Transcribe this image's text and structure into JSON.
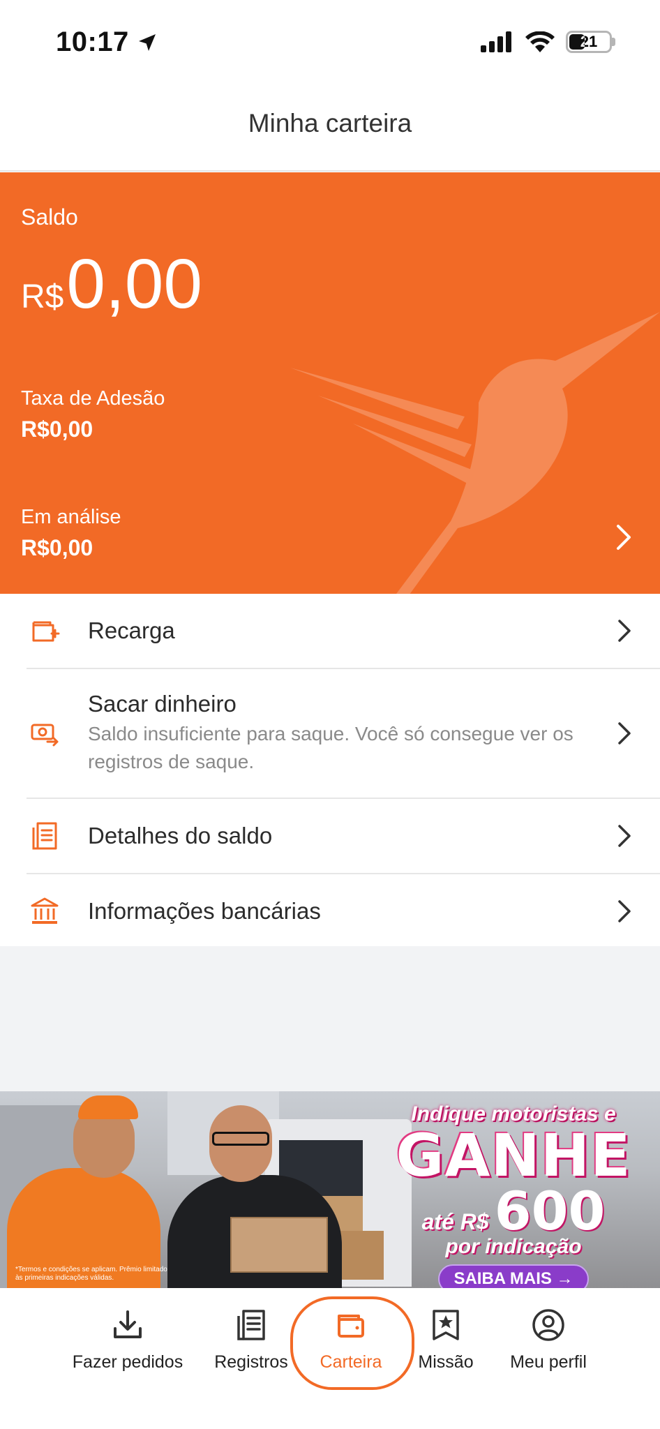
{
  "status_bar": {
    "time": "10:17",
    "battery": "21"
  },
  "header": {
    "title": "Minha carteira"
  },
  "balance": {
    "label": "Saldo",
    "currency": "R$",
    "amount": "0,00",
    "fee_label": "Taxa de Adesão",
    "fee_value": "R$0,00",
    "analysis_label": "Em análise",
    "analysis_value": "R$0,00"
  },
  "menu": [
    {
      "title": "Recarga",
      "icon": "wallet-add-icon"
    },
    {
      "title": "Sacar dinheiro",
      "subtitle": "Saldo insuficiente para saque. Você só consegue ver os registros de saque.",
      "icon": "cash-withdraw-icon"
    },
    {
      "title": "Detalhes do saldo",
      "icon": "document-list-icon"
    },
    {
      "title": "Informações bancárias",
      "icon": "bank-icon"
    }
  ],
  "banner": {
    "line1": "Indique motoristas e",
    "line2": "GANHE",
    "line3_prefix": "até R$",
    "line3_value": "600",
    "line4": "por indicação",
    "button": "SAIBA MAIS →",
    "terms": "*Termos e condições se aplicam. Prêmio limitado às primeiras indicações válidas."
  },
  "tabs": [
    {
      "label": "Fazer pedidos",
      "icon": "download-icon"
    },
    {
      "label": "Registros",
      "icon": "records-icon"
    },
    {
      "label": "Carteira",
      "icon": "wallet-icon",
      "active": true
    },
    {
      "label": "Missão",
      "icon": "star-badge-icon"
    },
    {
      "label": "Meu perfil",
      "icon": "user-icon"
    }
  ],
  "colors": {
    "accent": "#f26a26",
    "background_gray": "#f2f3f5"
  }
}
